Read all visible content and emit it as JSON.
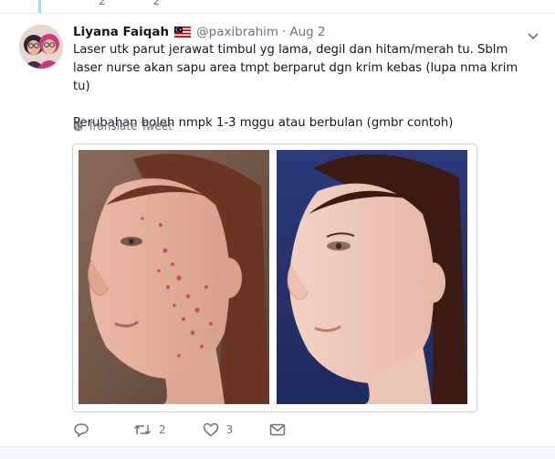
{
  "tweet": {
    "author_name": "Liyana Faiqah",
    "handle": "@paxibrahim",
    "separator": "·",
    "date": "Aug 2",
    "text": "Laser utk parut jerawat timbul yg lama, degil dan hitam/merah tu. Sblm laser nurse akan sapu area tmpt berparut dgn krim kebas (lupa nma krim tu)\n\nPerubahan boleh nmpk 1-3 mggu atau berbulan (gmbr contoh)",
    "translate_label": "Translate Tweet"
  },
  "actions": {
    "reply_count": "",
    "retweet_count": "2",
    "like_count": "3"
  },
  "top_peek": {
    "first": "2",
    "second": "2"
  },
  "icons": {
    "flag": "malaysia-flag-icon",
    "caret": "chevron-down-icon",
    "globe": "globe-icon",
    "reply": "reply-icon",
    "retweet": "retweet-icon",
    "like": "heart-icon",
    "dm": "envelope-icon"
  },
  "colors": {
    "text_primary": "#14171a",
    "text_secondary": "#657786",
    "border": "#ccd6dd",
    "thread_line": "#a9d8f5"
  }
}
